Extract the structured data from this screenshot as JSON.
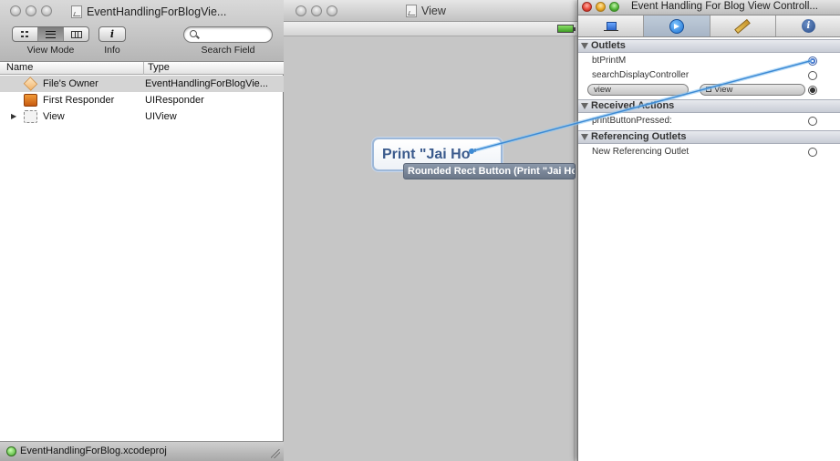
{
  "document_window": {
    "title": "EventHandlingForBlogVie...",
    "toolbar": {
      "view_mode_label": "View Mode",
      "info_label": "Info",
      "info_glyph": "i",
      "search_label": "Search Field",
      "search_placeholder": ""
    },
    "columns": {
      "name": "Name",
      "type": "Type"
    },
    "rows": [
      {
        "name": "File's Owner",
        "type": "EventHandlingForBlogVie...",
        "icon": "cube-icon"
      },
      {
        "name": "First Responder",
        "type": "UIResponder",
        "icon": "responder-icon"
      },
      {
        "name": "View",
        "type": "UIView",
        "icon": "view-icon"
      }
    ],
    "status": "EventHandlingForBlog.xcodeproj"
  },
  "view_window": {
    "title": "View",
    "button_label": "Print \"Jai Ho\"",
    "tooltip": "Rounded Rect Button (Print \"Jai Ho\")"
  },
  "inspector": {
    "title": "Event Handling For Blog View Controll...",
    "sections": {
      "outlets": "Outlets",
      "received_actions": "Received Actions",
      "referencing_outlets": "Referencing Outlets"
    },
    "outlets": [
      {
        "label": "btPrintM"
      },
      {
        "label": "searchDisplayController"
      }
    ],
    "view_connection": {
      "outlet": "view",
      "target": "View"
    },
    "actions": [
      {
        "label": "printButtonPressed:"
      }
    ],
    "referencing": [
      {
        "label": "New Referencing Outlet"
      }
    ]
  },
  "colors": {
    "desktop": "#1a4a52",
    "connection_line": "#5aa9e6",
    "button_text": "#3a5a8c",
    "selection": "#d4d4d4"
  }
}
